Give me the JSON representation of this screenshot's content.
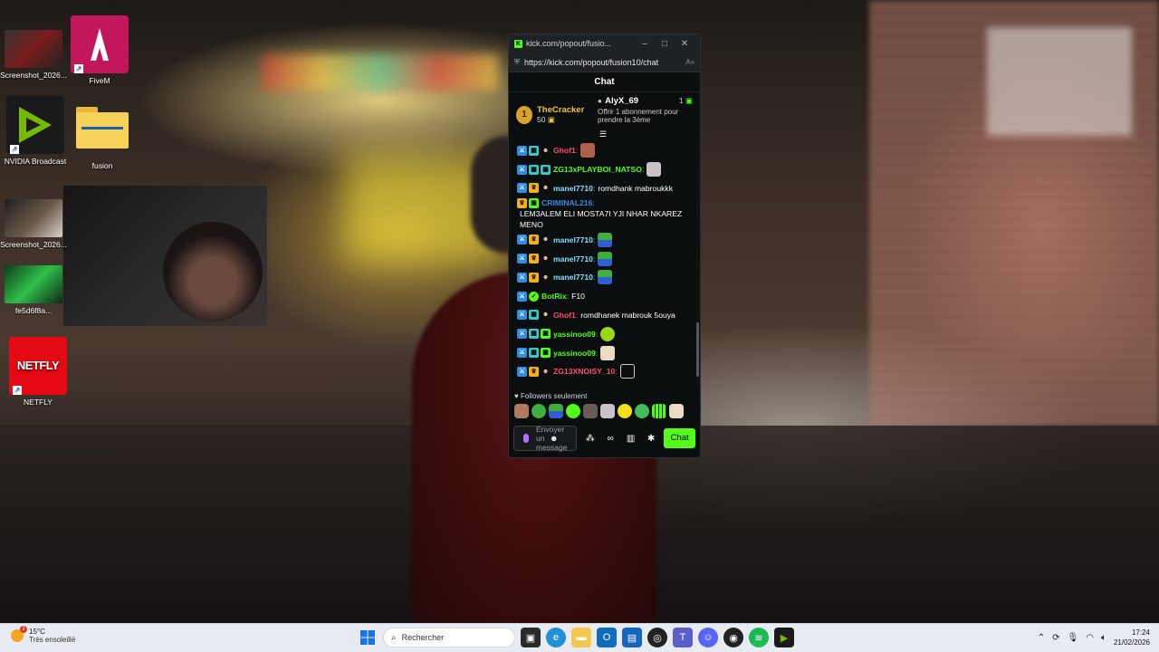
{
  "desktop": {
    "icons": [
      {
        "label": "Screenshot_2026..."
      },
      {
        "label": "FiveM"
      },
      {
        "label": "NVIDIA Broadcast"
      },
      {
        "label": "fusion"
      },
      {
        "label": "Screenshot_2026..."
      },
      {
        "label": "fe5d6f8a..."
      },
      {
        "label": "NETFLY"
      }
    ],
    "netfly_logo": "NETFLY"
  },
  "browser": {
    "title": "kick.com/popout/fusio...",
    "url": "https://kick.com/popout/fusion10/chat"
  },
  "chat": {
    "header": "Chat",
    "pinned": {
      "top_gifter_rank": "1",
      "top_gifter_name": "TheCracker",
      "top_gifter_count": "50",
      "offer_user": "AlyX_69",
      "offer_count": "1",
      "offer_text": "Offrir 1 abonnement pour prendre la 3ème"
    },
    "messages": [
      {
        "user": "Ghof1",
        "color": "#ff4d6d",
        "text": ""
      },
      {
        "user": "ZG13xPLAYBOI_NATSO",
        "color": "#53fc18",
        "text": ""
      },
      {
        "user": "manel7710",
        "color": "#7ee0ff",
        "text": "romdhank mabroukkk"
      },
      {
        "user": "CRIMINAL216",
        "color": "#2f8de4",
        "text": "LEM3ALEM ELI MOSTA7I YJI NHAR NKAREZ MENO"
      },
      {
        "user": "manel7710",
        "color": "#7ee0ff",
        "text": ""
      },
      {
        "user": "manel7710",
        "color": "#7ee0ff",
        "text": ""
      },
      {
        "user": "manel7710",
        "color": "#7ee0ff",
        "text": ""
      },
      {
        "user": "BotRix",
        "color": "#53fc18",
        "text": "F10"
      },
      {
        "user": "Ghof1",
        "color": "#ff4d6d",
        "text": "romdhanek mabrouk 5ouya"
      },
      {
        "user": "yassinoo09",
        "color": "#53fc18",
        "text": ""
      },
      {
        "user": "yassinoo09",
        "color": "#53fc18",
        "text": ""
      },
      {
        "user": "ZG13XNOISY_10",
        "color": "#ff4d6d",
        "text": ""
      }
    ],
    "followers_mode": "Followers seulement",
    "input_placeholder": "Envoyer un message",
    "send_label": "Chat"
  },
  "taskbar": {
    "weather_temp": "15°C",
    "weather_desc": "Très ensoleillé",
    "weather_badge": "2",
    "search_placeholder": "Rechercher",
    "time": "17:24",
    "date": "21/02/2026"
  },
  "colors": {
    "kick_green": "#53fc18",
    "chat_bg": "#0b0e0f",
    "taskbar_bg": "#e8ecf2"
  }
}
